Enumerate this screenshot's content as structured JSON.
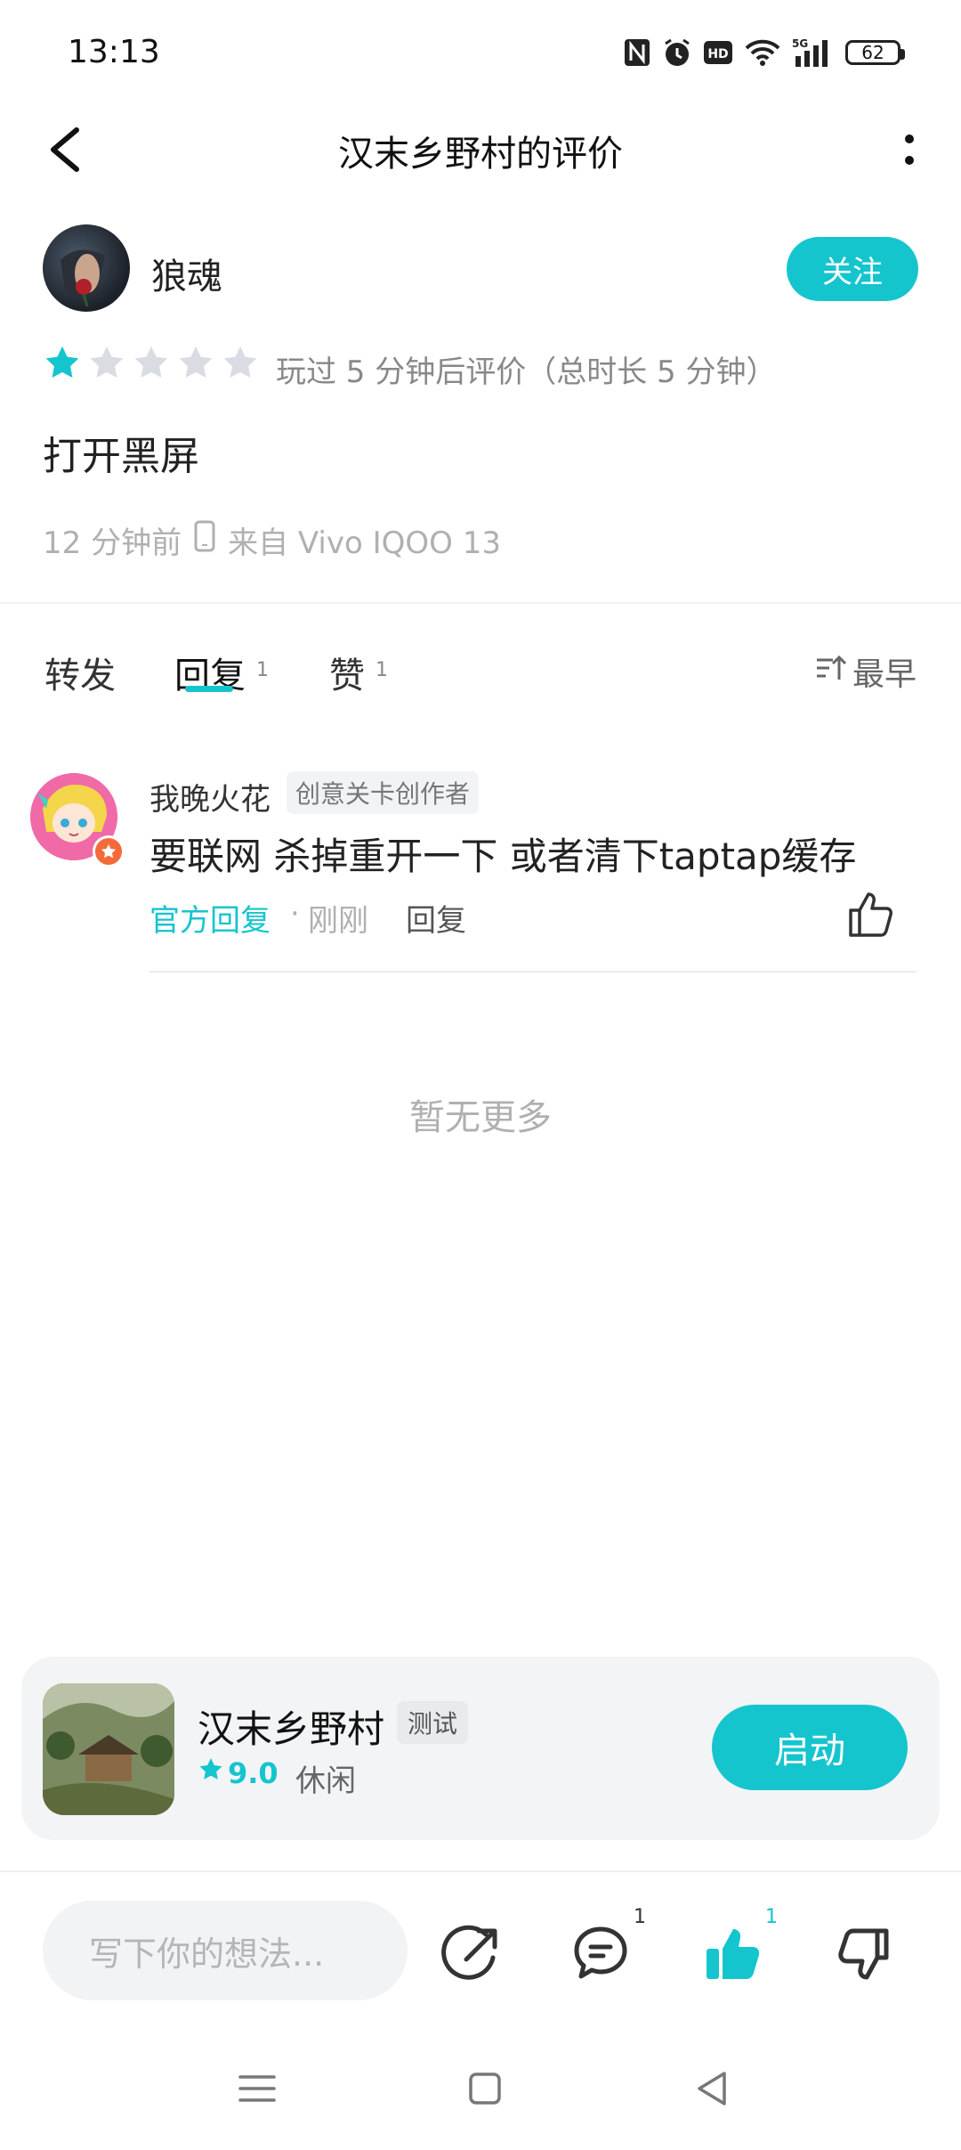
{
  "status_bar": {
    "time": "13:13",
    "network": "5G",
    "battery": "62"
  },
  "header": {
    "title": "汉末乡野村的评价"
  },
  "review": {
    "author": "狼魂",
    "follow_label": "关注",
    "rating": 1,
    "max_rating": 5,
    "play_info": "玩过 5 分钟后评价（总时长 5 分钟）",
    "text": "打开黑屏",
    "time": "12 分钟前",
    "device": "来自 Vivo IQOO 13"
  },
  "tabs": [
    {
      "label": "转发",
      "count": ""
    },
    {
      "label": "回复",
      "count": "1"
    },
    {
      "label": "赞",
      "count": "1"
    }
  ],
  "sort_label": "最早",
  "reply": {
    "name": "我晚火花",
    "tag": "创意关卡创作者",
    "text": "要联网 杀掉重开一下 或者清下taptap缓存",
    "official": "官方回复",
    "dot": "·",
    "time": "刚刚",
    "reply_label": "回复"
  },
  "no_more": "暂无更多",
  "game": {
    "name": "汉末乡野村",
    "tag": "测试",
    "rating": "9.0",
    "genre": "休闲",
    "launch_label": "启动"
  },
  "bottom_bar": {
    "input_placeholder": "写下你的想法...",
    "comment_count": "1",
    "like_count": "1"
  },
  "colors": {
    "accent": "#15c5ce",
    "star_empty": "#d9dde3"
  }
}
